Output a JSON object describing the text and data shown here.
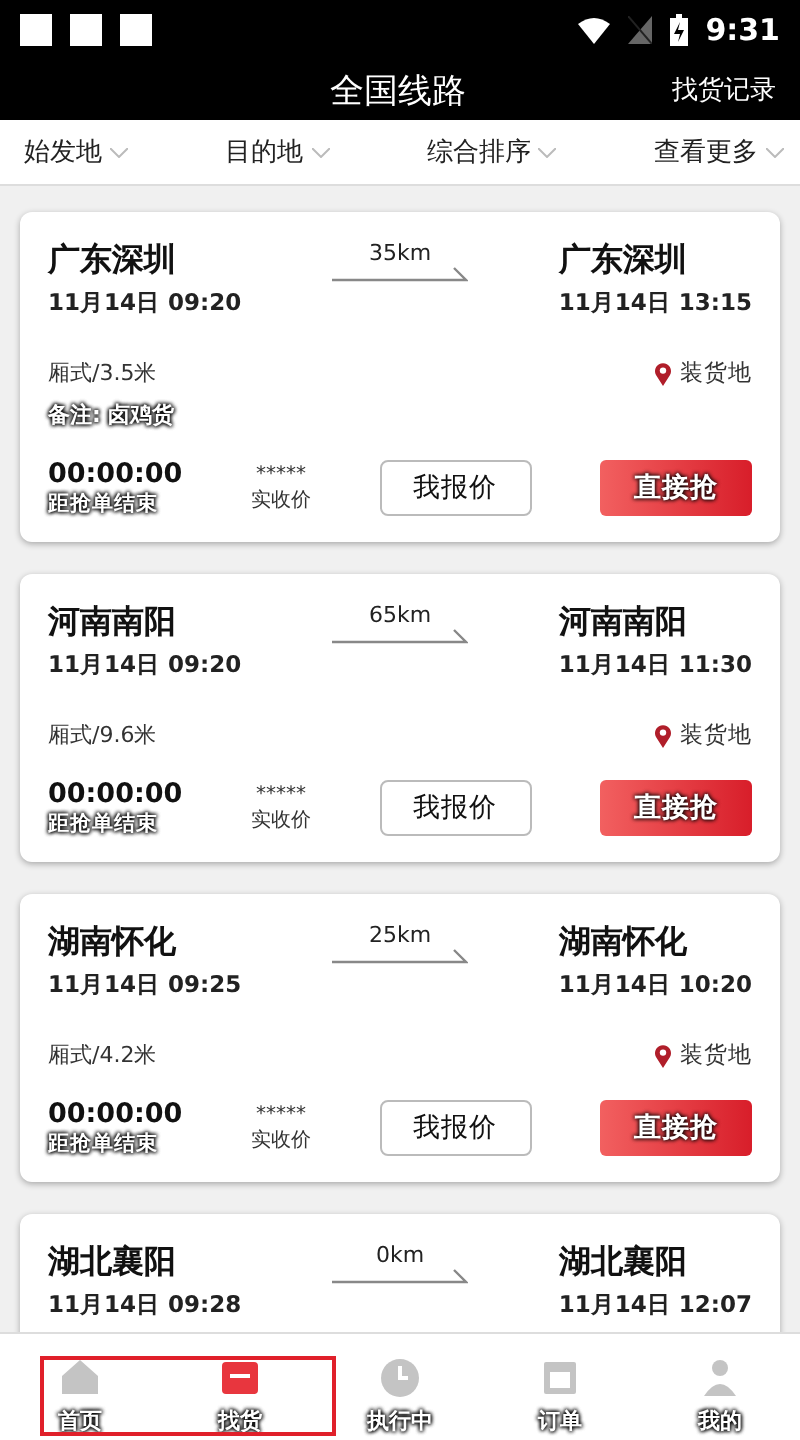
{
  "status_bar": {
    "time": "9:31"
  },
  "header": {
    "title": "全国线路",
    "action": "找货记录"
  },
  "filters": [
    {
      "label": "始发地"
    },
    {
      "label": "目的地"
    },
    {
      "label": "综合排序"
    },
    {
      "label": "查看更多"
    }
  ],
  "routes": [
    {
      "origin": "广东深圳",
      "origin_time": "11月14日 09:20",
      "distance": "35km",
      "destination": "广东深圳",
      "destination_time": "11月14日 13:15",
      "vehicle": "厢式/3.5米",
      "location_label": "装货地",
      "note": "备注: 卤鸡货",
      "countdown": "00:00:00",
      "countdown_label": "距抢单结束",
      "price": "*****",
      "price_label": "实收价",
      "quote_button": "我报价",
      "grab_button": "直接抢"
    },
    {
      "origin": "河南南阳",
      "origin_time": "11月14日 09:20",
      "distance": "65km",
      "destination": "河南南阳",
      "destination_time": "11月14日 11:30",
      "vehicle": "厢式/9.6米",
      "location_label": "装货地",
      "countdown": "00:00:00",
      "countdown_label": "距抢单结束",
      "price": "*****",
      "price_label": "实收价",
      "quote_button": "我报价",
      "grab_button": "直接抢"
    },
    {
      "origin": "湖南怀化",
      "origin_time": "11月14日 09:25",
      "distance": "25km",
      "destination": "湖南怀化",
      "destination_time": "11月14日 10:20",
      "vehicle": "厢式/4.2米",
      "location_label": "装货地",
      "countdown": "00:00:00",
      "countdown_label": "距抢单结束",
      "price": "*****",
      "price_label": "实收价",
      "quote_button": "我报价",
      "grab_button": "直接抢"
    },
    {
      "origin": "湖北襄阳",
      "origin_time": "11月14日 09:28",
      "distance": "0km",
      "destination": "湖北襄阳",
      "destination_time": "11月14日 12:07"
    }
  ],
  "bottom_nav": [
    {
      "label": "首页",
      "kind": "home",
      "selected": false,
      "highlighted": true
    },
    {
      "label": "找货",
      "kind": "box",
      "selected": true,
      "highlighted": true
    },
    {
      "label": "执行中",
      "kind": "clock",
      "selected": false,
      "highlighted": false
    },
    {
      "label": "订单",
      "kind": "calendar",
      "selected": false,
      "highlighted": false
    },
    {
      "label": "我的",
      "kind": "person",
      "selected": false,
      "highlighted": false
    }
  ]
}
